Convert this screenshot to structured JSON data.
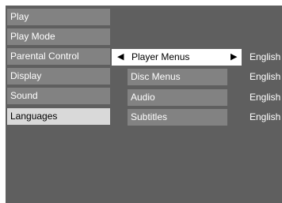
{
  "main_menu": {
    "items": [
      {
        "label": "Play"
      },
      {
        "label": "Play Mode"
      },
      {
        "label": "Parental Control"
      },
      {
        "label": "Display"
      },
      {
        "label": "Sound"
      },
      {
        "label": "Languages",
        "selected": true
      }
    ]
  },
  "languages_menu": {
    "items": [
      {
        "label": "Player Menus",
        "value": "English",
        "selected": true
      },
      {
        "label": "Disc Menus",
        "value": "English"
      },
      {
        "label": "Audio",
        "value": "English"
      },
      {
        "label": "Subtitles",
        "value": "English"
      }
    ],
    "left_arrow_icon": "left-triangle",
    "right_arrow_icon": "right-triangle"
  }
}
